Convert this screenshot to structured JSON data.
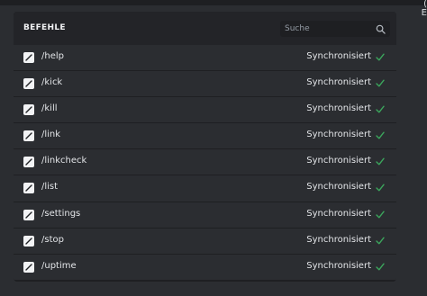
{
  "panel": {
    "title": "BEFEHLE",
    "search_placeholder": "Suche"
  },
  "commands": [
    {
      "name": "/help",
      "status": "Synchronisiert"
    },
    {
      "name": "/kick",
      "status": "Synchronisiert"
    },
    {
      "name": "/kill",
      "status": "Synchronisiert"
    },
    {
      "name": "/link",
      "status": "Synchronisiert"
    },
    {
      "name": "/linkcheck",
      "status": "Synchronisiert"
    },
    {
      "name": "/list",
      "status": "Synchronisiert"
    },
    {
      "name": "/settings",
      "status": "Synchronisiert"
    },
    {
      "name": "/stop",
      "status": "Synchronisiert"
    },
    {
      "name": "/uptime",
      "status": "Synchronisiert"
    }
  ],
  "icons": {
    "command": "slash-command-icon",
    "status": "checkmark-icon",
    "search": "search-icon"
  },
  "colors": {
    "background": "#2b2d31",
    "panel": "#1e1f22",
    "row": "#2b2d31",
    "check": "#3ba55c",
    "text": "#e3e5e8"
  }
}
